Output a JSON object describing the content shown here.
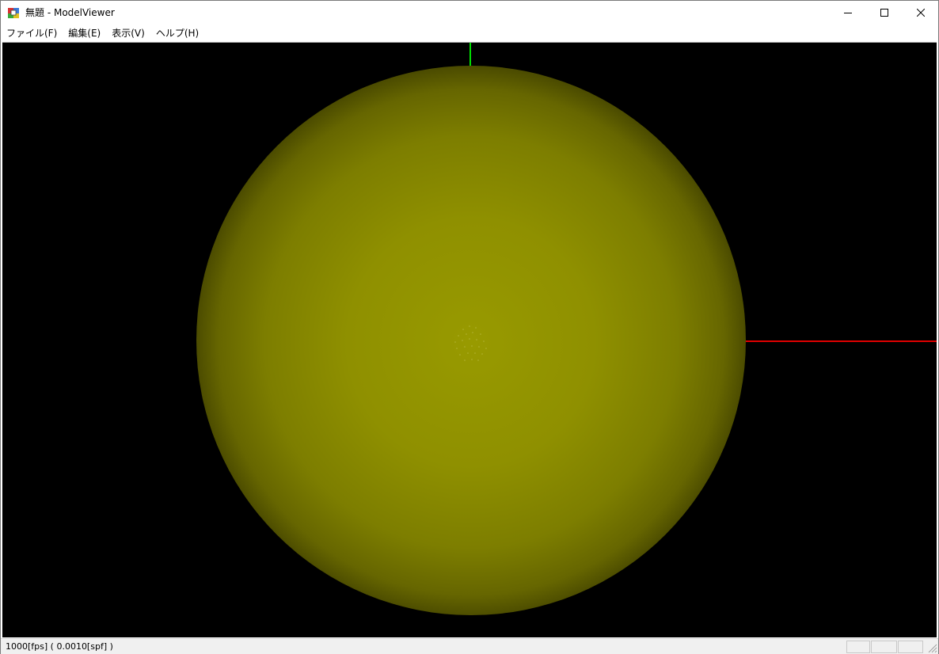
{
  "window": {
    "title": "無題 - ModelViewer"
  },
  "menu": {
    "items": [
      {
        "label": "ファイル(F)"
      },
      {
        "label": "編集(E)"
      },
      {
        "label": "表示(V)"
      },
      {
        "label": "ヘルプ(H)"
      }
    ]
  },
  "viewport": {
    "background_color": "#000000",
    "sphere_color": "#9a9a00",
    "y_axis_color": "#00e000",
    "x_axis_color": "#e00000"
  },
  "status": {
    "text": "1000[fps] ( 0.0010[spf] )"
  },
  "icons": {
    "app": "model-viewer-app-icon",
    "minimize": "minimize-icon",
    "maximize": "maximize-icon",
    "close": "close-icon",
    "grip": "resize-grip-icon"
  }
}
